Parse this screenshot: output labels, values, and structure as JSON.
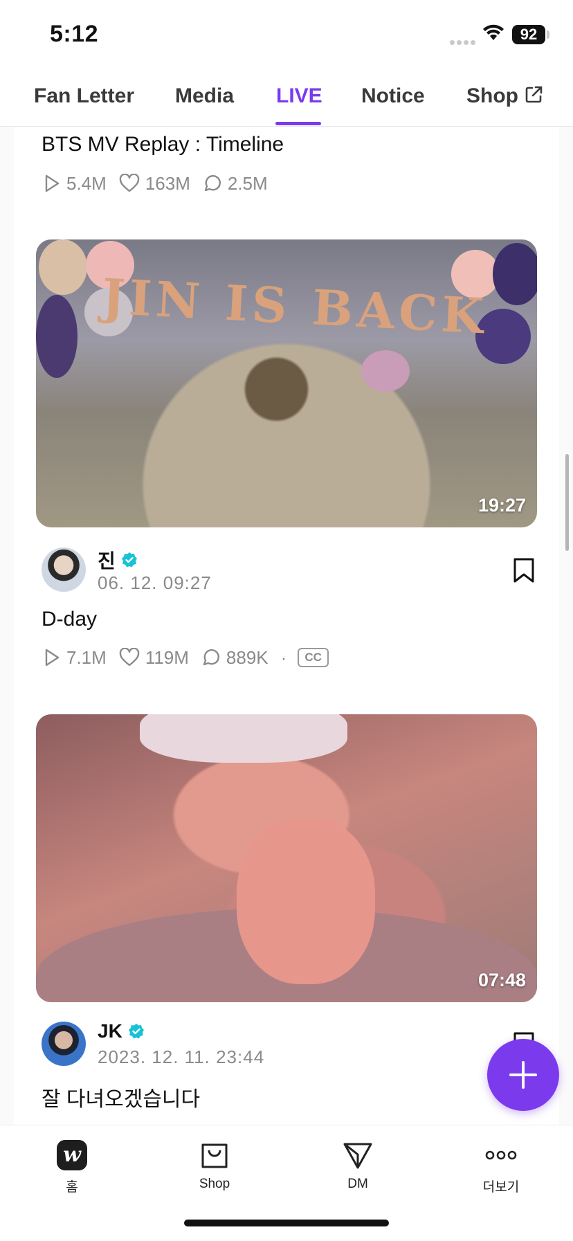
{
  "status_bar": {
    "time": "5:12",
    "battery": "92"
  },
  "tabs": [
    {
      "label": "Fan Letter",
      "active": false
    },
    {
      "label": "Media",
      "active": false
    },
    {
      "label": "LIVE",
      "active": true
    },
    {
      "label": "Notice",
      "active": false
    },
    {
      "label": "Shop",
      "active": false,
      "external": true
    }
  ],
  "accent_color": "#7c3aed",
  "posts": [
    {
      "title": "BTS MV Replay : Timeline",
      "stats": {
        "plays": "5.4M",
        "likes": "163M",
        "comments": "2.5M"
      }
    },
    {
      "thumbnail_text": "JIN IS BACK",
      "duration": "19:27",
      "author": "진",
      "verified": true,
      "date": "06. 12. 09:27",
      "title": "D-day",
      "stats": {
        "plays": "7.1M",
        "likes": "119M",
        "comments": "889K",
        "separator": "·",
        "cc": "CC"
      }
    },
    {
      "duration": "07:48",
      "author": "JK",
      "verified": true,
      "date": "2023. 12. 11. 23:44",
      "title": "잘 다녀오겠습니다"
    }
  ],
  "bottom_nav": [
    {
      "label": "홈",
      "icon": "weverse-logo-icon",
      "logo_text": "w"
    },
    {
      "label": "Shop",
      "icon": "shopping-bag-icon"
    },
    {
      "label": "DM",
      "icon": "paper-plane-icon"
    },
    {
      "label": "더보기",
      "icon": "more-dots-icon"
    }
  ]
}
